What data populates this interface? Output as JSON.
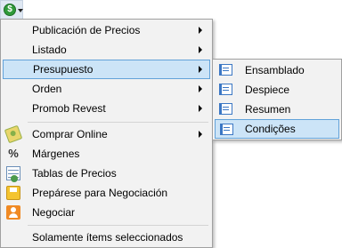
{
  "main_menu": {
    "items": [
      {
        "label": "Publicación de Precios",
        "has_submenu": true
      },
      {
        "label": "Listado",
        "has_submenu": true
      },
      {
        "label": "Presupuesto",
        "has_submenu": true,
        "active": true
      },
      {
        "label": "Orden",
        "has_submenu": true
      },
      {
        "label": "Promob Revest",
        "has_submenu": true
      },
      {
        "label": "Comprar Online",
        "has_submenu": true,
        "icon": "money-icon"
      },
      {
        "label": "Márgenes",
        "icon": "percent-icon"
      },
      {
        "label": "Tablas de Precios",
        "icon": "price-table-icon"
      },
      {
        "label": "Prepárese para Negociación",
        "icon": "save-icon"
      },
      {
        "label": "Negociar",
        "icon": "user-icon"
      },
      {
        "label": "Solamente ítems seleccionados"
      }
    ]
  },
  "submenu": {
    "items": [
      {
        "label": "Ensamblado",
        "icon": "report-icon"
      },
      {
        "label": "Despiece",
        "icon": "report-icon"
      },
      {
        "label": "Resumen",
        "icon": "report-icon"
      },
      {
        "label": "Condições",
        "icon": "report-icon",
        "active": true
      }
    ]
  },
  "toolbar": {
    "button_icon": "price-coin-icon",
    "coin_symbol": "$"
  },
  "colors": {
    "highlight_bg": "#cce4f7",
    "highlight_border": "#62a2d9",
    "menu_bg": "#f2f2f2"
  }
}
